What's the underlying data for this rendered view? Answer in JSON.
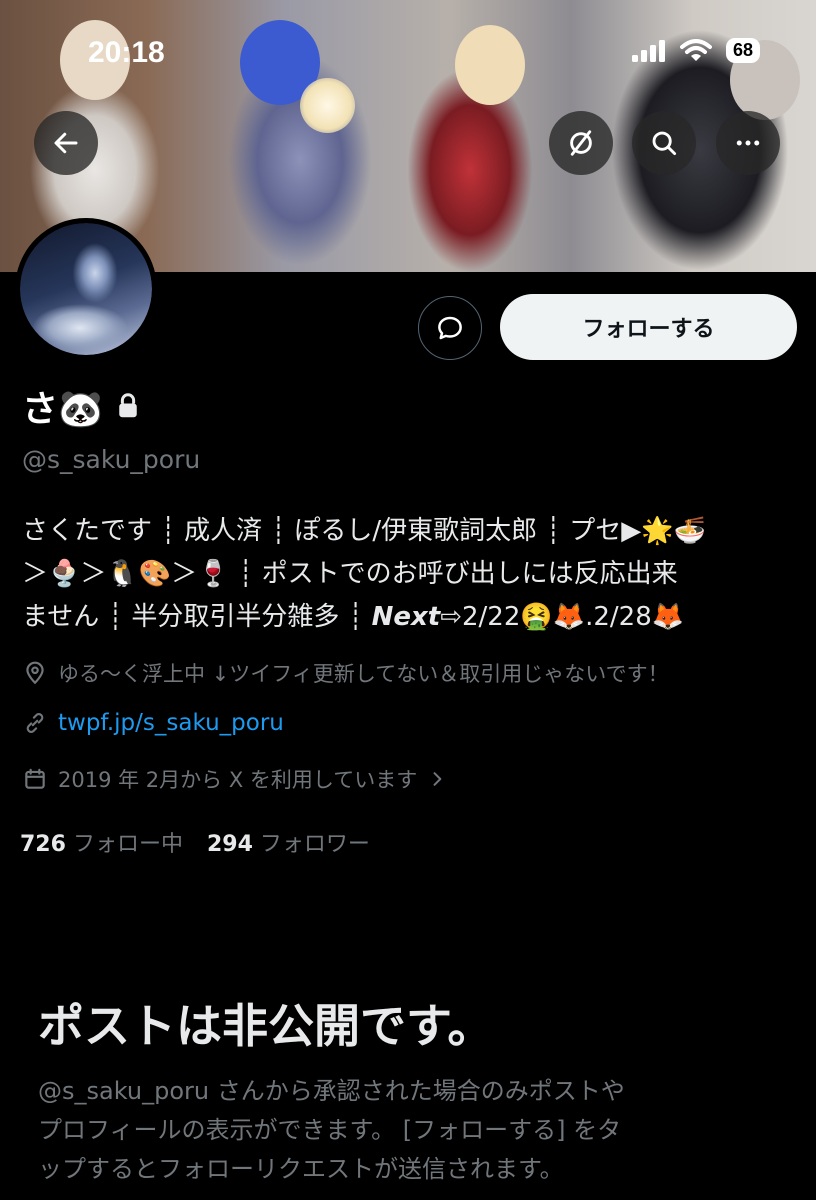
{
  "status_bar": {
    "time": "20:18",
    "battery": "68"
  },
  "header": {
    "back_icon": "arrow-left-icon",
    "grok_icon": "slashed-circle-icon",
    "search_icon": "search-icon",
    "more_icon": "more-horizontal-icon"
  },
  "profile": {
    "name": "さ🐼",
    "lock_icon": "lock-icon",
    "handle": "@s_saku_poru",
    "follow_label": "フォローする",
    "message_icon": "message-bubble-icon",
    "bio": {
      "line1": "さくたです ┊ 成人済 ┊ ぽるし/伊東歌詞太郎 ┊ プセ▶🌟🍜",
      "line2": "＞🍨＞🐧🎨＞🍷 ┊ ポストでのお呼び出しには反応出来",
      "line3_pre": "ません ┊ 半分取引半分雑多 ┊ ",
      "line3_next": "Next",
      "line3_post": "⇨2/22🤮🦊.2/28🦊"
    },
    "location": "ゆる〜く浮上中 ↓ツイフィ更新してない＆取引用じゃないです！",
    "website": "twpf.jp/s_saku_poru",
    "joined": "2019 年 2月から X を利用しています",
    "following_count": "726",
    "following_label": "フォロー中",
    "followers_count": "294",
    "followers_label": "フォロワー"
  },
  "private_notice": {
    "title": "ポストは非公開です。",
    "line1": "@s_saku_poru さんから承認された場合のみポストや",
    "line2": "プロフィールの表示ができます。 [フォローする] をタ",
    "line3": "ップするとフォローリクエストが送信されます。"
  }
}
